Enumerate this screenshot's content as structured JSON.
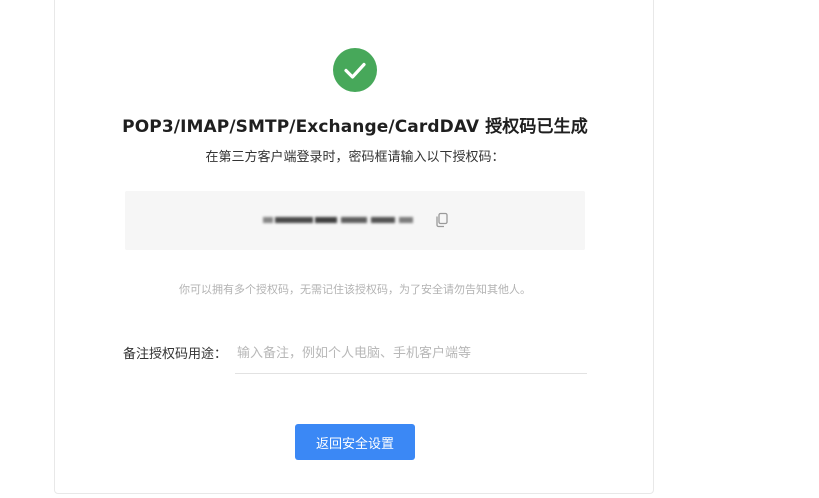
{
  "success": {
    "icon": "check-circle-icon",
    "color": "#47a85a",
    "title": "POP3/IMAP/SMTP/Exchange/CardDAV 授权码已生成",
    "subtitle": "在第三方客户端登录时，密码框请输入以下授权码："
  },
  "auth_code": {
    "masked": true,
    "copy_icon": "copy-icon"
  },
  "hint": "你可以拥有多个授权码，无需记住该授权码，为了安全请勿告知其他人。",
  "note": {
    "label": "备注授权码用途：",
    "placeholder": "输入备注，例如个人电脑、手机客户端等",
    "value": ""
  },
  "actions": {
    "back_label": "返回安全设置",
    "button_color": "#3b88f5"
  }
}
